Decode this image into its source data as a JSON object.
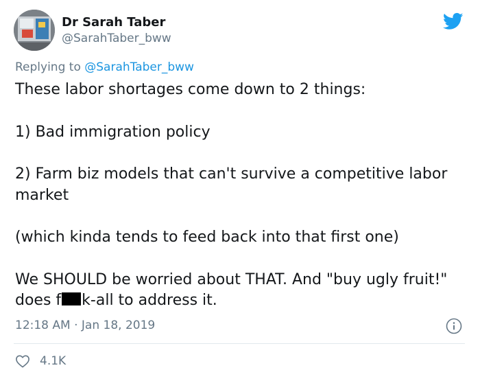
{
  "author": {
    "display_name": "Dr Sarah Taber",
    "handle": "@SarahTaber_bww",
    "avatar_icon": "profile-photo"
  },
  "reply": {
    "prefix": "Replying to",
    "mention": "@SarahTaber_bww"
  },
  "tweet": {
    "para1": "These labor shortages come down to 2 things:",
    "para2": "1) Bad immigration policy",
    "para3": "2) Farm biz models that can't survive a competitive labor market",
    "para4": "(which kinda tends to feed back into that first one)",
    "para5_before": "We SHOULD be worried about THAT. And \"buy ugly fruit!\" does f",
    "para5_after": "k-all to address it."
  },
  "meta": {
    "timestamp": "12:18 AM · Jan 18, 2019"
  },
  "engagement": {
    "likes": "4.1K"
  },
  "colors": {
    "brand": "#1da1f2",
    "mention": "#1b95e0",
    "secondary_text": "#657786"
  },
  "icons": {
    "brand": "twitter-bird-icon",
    "info": "info-icon",
    "like": "heart-icon"
  }
}
